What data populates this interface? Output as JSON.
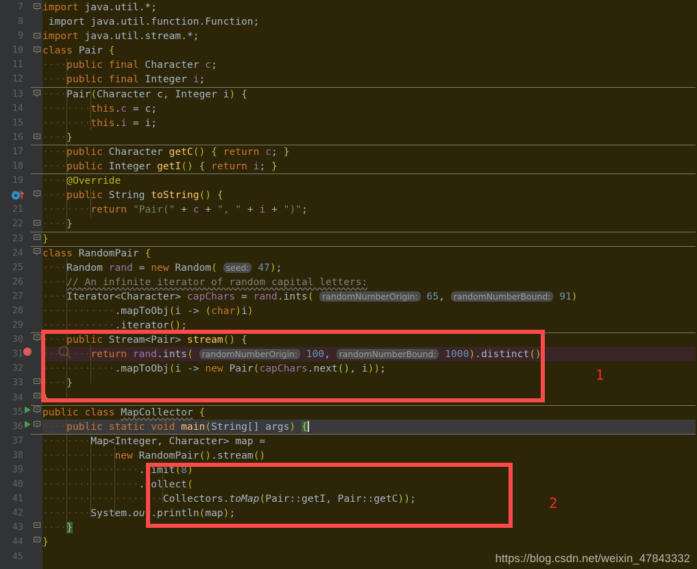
{
  "app": {
    "name": "IntelliJ IDEA Java Editor",
    "file_language": "Java"
  },
  "editor": {
    "first_line_number": 7,
    "last_line_number": 45,
    "caret_line": 36,
    "breakpoint_line": 31,
    "colors": {
      "code_background": "#2c2507",
      "gutter_background": "#313335",
      "caret_line_highlight": "#3a3a3c",
      "breakpoint_line_highlight": "#3b2526",
      "keyword": "#cc7832",
      "string": "#6a8759",
      "number": "#6897bb",
      "comment": "#808080",
      "field": "#9876aa",
      "method": "#ffc66d",
      "annotation": "#bbb529",
      "identifier": "#a9b7c6",
      "annotation_red": "#fb4a4a",
      "breakpoint_red": "#db5c5c",
      "run_green": "#499c54"
    },
    "lines": [
      {
        "n": 7,
        "text": "import java.util.*;"
      },
      {
        "n": 8,
        "text": "import java.util.function.Function;"
      },
      {
        "n": 9,
        "text": "import java.util.stream.*;"
      },
      {
        "n": 10,
        "text": "class Pair {"
      },
      {
        "n": 11,
        "text": "    public final Character c;"
      },
      {
        "n": 12,
        "text": "    public final Integer i;"
      },
      {
        "n": 13,
        "text": "    Pair(Character c, Integer i) {"
      },
      {
        "n": 14,
        "text": "        this.c = c;"
      },
      {
        "n": 15,
        "text": "        this.i = i;"
      },
      {
        "n": 16,
        "text": "    }"
      },
      {
        "n": 17,
        "text": "    public Character getC() { return c; }"
      },
      {
        "n": 18,
        "text": "    public Integer getI() { return i; }"
      },
      {
        "n": 19,
        "text": "    @Override"
      },
      {
        "n": 20,
        "text": "    public String toString() {"
      },
      {
        "n": 21,
        "text": "        return \"Pair(\" + c + \", \" + i + \")\";"
      },
      {
        "n": 22,
        "text": "    }"
      },
      {
        "n": 23,
        "text": "}"
      },
      {
        "n": 24,
        "text": "class RandomPair {"
      },
      {
        "n": 25,
        "text": "    Random rand = new Random( seed: 47);"
      },
      {
        "n": 26,
        "text": "    // An infinite iterator of random capital letters:"
      },
      {
        "n": 27,
        "text": "    Iterator<Character> capChars = rand.ints( randomNumberOrigin: 65, randomNumberBound: 91)"
      },
      {
        "n": 28,
        "text": "            .mapToObj(i -> (char)i)"
      },
      {
        "n": 29,
        "text": "            .iterator();"
      },
      {
        "n": 30,
        "text": "    public Stream<Pair> stream() {"
      },
      {
        "n": 31,
        "text": "        return rand.ints( randomNumberOrigin: 100, randomNumberBound: 1000).distinct()"
      },
      {
        "n": 32,
        "text": "            .mapToObj(i -> new Pair(capChars.next(), i));"
      },
      {
        "n": 33,
        "text": "    }"
      },
      {
        "n": 34,
        "text": "}"
      },
      {
        "n": 35,
        "text": "public class MapCollector {"
      },
      {
        "n": 36,
        "text": "    public static void main(String[] args) {"
      },
      {
        "n": 37,
        "text": "        Map<Integer, Character> map ="
      },
      {
        "n": 38,
        "text": "            new RandomPair().stream()"
      },
      {
        "n": 39,
        "text": "                .limit(8)"
      },
      {
        "n": 40,
        "text": "                .collect("
      },
      {
        "n": 41,
        "text": "                    Collectors.toMap(Pair::getI, Pair::getC));"
      },
      {
        "n": 42,
        "text": "        System.out.println(map);"
      },
      {
        "n": 43,
        "text": "    }"
      },
      {
        "n": 44,
        "text": "}"
      },
      {
        "n": 45,
        "text": ""
      }
    ],
    "param_hints": [
      {
        "line": 25,
        "label": "seed:",
        "value": "47"
      },
      {
        "line": 27,
        "label": "randomNumberOrigin:",
        "value": "65"
      },
      {
        "line": 27,
        "label": "randomNumberBound:",
        "value": "91"
      },
      {
        "line": 31,
        "label": "randomNumberOrigin:",
        "value": "100"
      },
      {
        "line": 31,
        "label": "randomNumberBound:",
        "value": "1000"
      }
    ],
    "gutter_markers": [
      {
        "line": 20,
        "type": "overridden-method-icon"
      },
      {
        "line": 31,
        "type": "breakpoint-icon"
      },
      {
        "line": 35,
        "type": "run-class-icon"
      },
      {
        "line": 36,
        "type": "run-method-icon"
      }
    ]
  },
  "annotations": [
    {
      "id": "1",
      "label": "1",
      "target_lines": "30-34"
    },
    {
      "id": "2",
      "label": "2",
      "target_lines": "39-43"
    }
  ],
  "watermark": {
    "text": "https://blog.csdn.net/weixin_47843332"
  }
}
